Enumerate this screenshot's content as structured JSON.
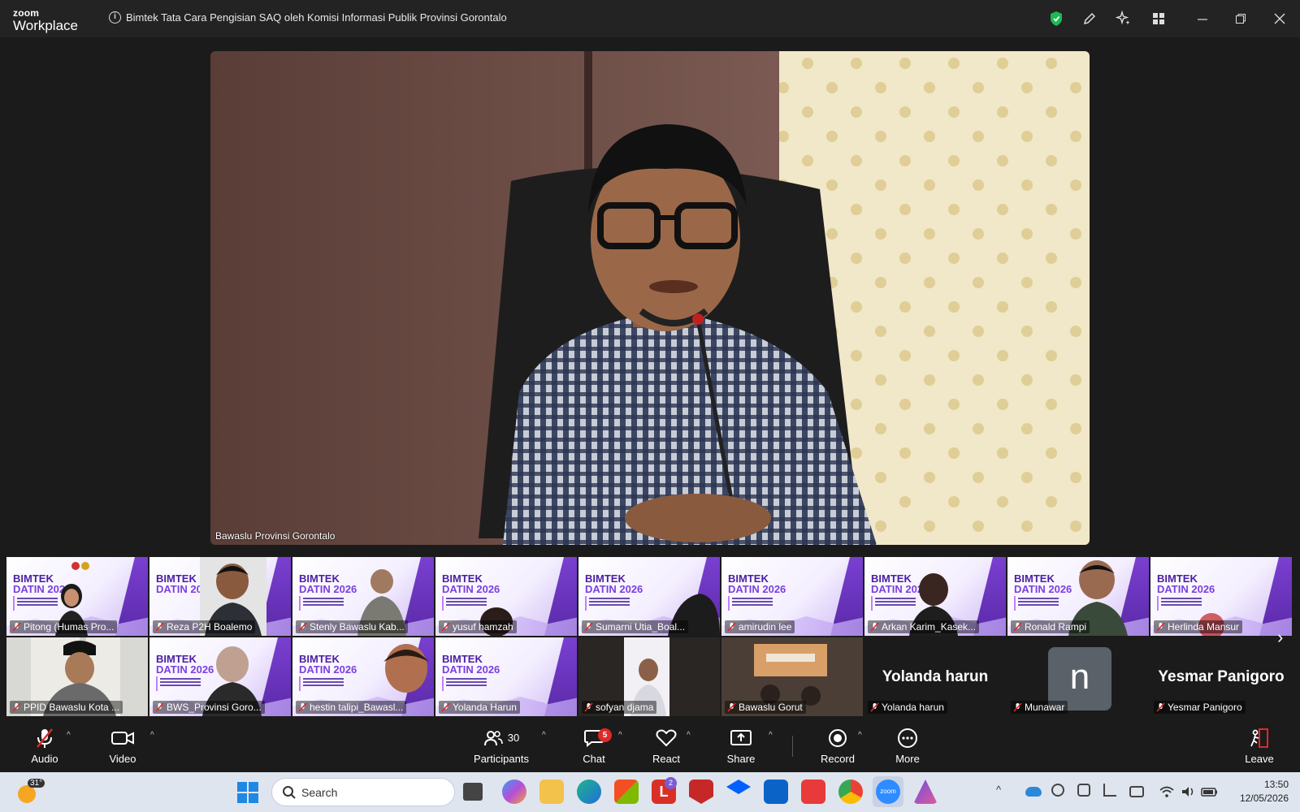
{
  "app": {
    "logo_top": "zoom",
    "logo_bottom": "Workplace",
    "meeting_title": "Bimtek Tata Cara Pengisian SAQ oleh Komisi Informasi Publik Provinsi Gorontalo"
  },
  "main_video": {
    "speaker_name": "Bawaslu Provinsi Gorontalo"
  },
  "slide": {
    "line1": "BIMTEK",
    "line2": "DATIN 2026"
  },
  "participants_row1": [
    {
      "name": "Pitong (Humas Pro..."
    },
    {
      "name": "Reza P2H Boalemo"
    },
    {
      "name": "Stenly Bawaslu Kab..."
    },
    {
      "name": "yusuf hamzah"
    },
    {
      "name": "Sumarni Utia_Boal..."
    },
    {
      "name": "amirudin lee"
    },
    {
      "name": "Arkan Karim_Kasek..."
    },
    {
      "name": "Ronald Rampi"
    },
    {
      "name": "Herlinda Mansur"
    }
  ],
  "participants_row2": [
    {
      "name": "PPID Bawaslu Kota ..."
    },
    {
      "name": "BWS_Provinsi Goro..."
    },
    {
      "name": "hestin talipi_Bawasl..."
    },
    {
      "name": "Yolanda Harun"
    },
    {
      "name": "sofyan djama"
    },
    {
      "name": "Bawaslu Gorut"
    },
    {
      "name": "Yolanda harun",
      "display": "Yolanda harun"
    },
    {
      "name": "Munawar",
      "avatar_letter": "n"
    },
    {
      "name": "Yesmar Panigoro",
      "display": "Yesmar Panigoro"
    }
  ],
  "controls": {
    "audio": "Audio",
    "video": "Video",
    "participants": "Participants",
    "participants_count": "30",
    "chat": "Chat",
    "chat_badge": "5",
    "react": "React",
    "share": "Share",
    "record": "Record",
    "more": "More",
    "leave": "Leave"
  },
  "taskbar": {
    "temperature": "31°",
    "search_placeholder": "Search",
    "time": "13:50",
    "date": "12/05/2026",
    "office_badge": "2"
  },
  "colors": {
    "accent_purple": "#7b3fe0",
    "leave_red": "#e02828",
    "shield_green": "#1db954"
  }
}
